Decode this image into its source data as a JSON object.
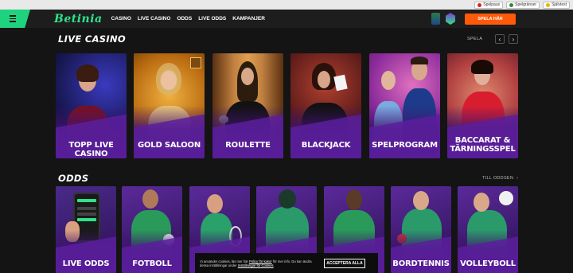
{
  "browser_bar": {
    "items": [
      {
        "label": "Spelpaus",
        "color": "#d22"
      },
      {
        "label": "Spelgränser",
        "color": "#2a8c3c"
      },
      {
        "label": "Självtest",
        "color": "#e6b700"
      }
    ]
  },
  "header": {
    "logo": "Betinia",
    "nav": [
      "CASINO",
      "LIVE CASINO",
      "ODDS",
      "LIVE ODDS",
      "KAMPANJER"
    ],
    "cta": "SPELA HÄR"
  },
  "live_casino": {
    "title": "LIVE CASINO",
    "link": "SPELA",
    "prev": "‹",
    "next": "›",
    "cards": [
      {
        "label": "TOPP LIVE CASINO"
      },
      {
        "label": "GOLD SALOON"
      },
      {
        "label": "ROULETTE"
      },
      {
        "label": "BLACKJACK"
      },
      {
        "label": "SPELPROGRAM"
      },
      {
        "label": "BACCARAT & TÄRNINGSSPEL"
      }
    ]
  },
  "odds": {
    "title": "ODDS",
    "link": "TILL ODDSEN",
    "cards": [
      {
        "label": "LIVE ODDS"
      },
      {
        "label": "FOTBOLL"
      },
      {
        "label": ""
      },
      {
        "label": ""
      },
      {
        "label": ""
      },
      {
        "label": ""
      },
      {
        "label": "BORDTENNIS"
      },
      {
        "label": "VOLLEYBOLL"
      }
    ]
  },
  "cookie": {
    "text_1": "Vi använder cookies, läs mer här",
    "link_1": "Policy för kakor",
    "text_2": "för mer info. Du kan ändra",
    "text_3": "dessa inställningar under",
    "link_2": "Inställningar för Cookies",
    "accept": "ACCEPTERA ALLA"
  },
  "colors": {
    "accent_green": "#2ee38a",
    "cta_orange": "#ff5a0a",
    "card_purple": "#4a1a86",
    "background": "#141414"
  }
}
